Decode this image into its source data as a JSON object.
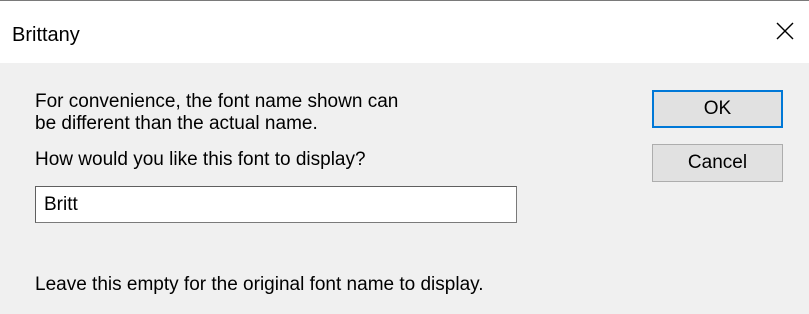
{
  "window": {
    "title": "Brittany",
    "close_icon": "close-icon"
  },
  "dialog": {
    "message_line1": "For convenience, the font name shown can",
    "message_line2": "be different than the actual name.",
    "prompt": "How would you like this font to display?",
    "input_value": "Britt",
    "hint": "Leave this empty for the original font name to display."
  },
  "buttons": {
    "ok_label": "OK",
    "cancel_label": "Cancel"
  },
  "colors": {
    "default_button_border": "#0078d7",
    "background": "#f0f0f0",
    "title_bar": "#ffffff"
  }
}
